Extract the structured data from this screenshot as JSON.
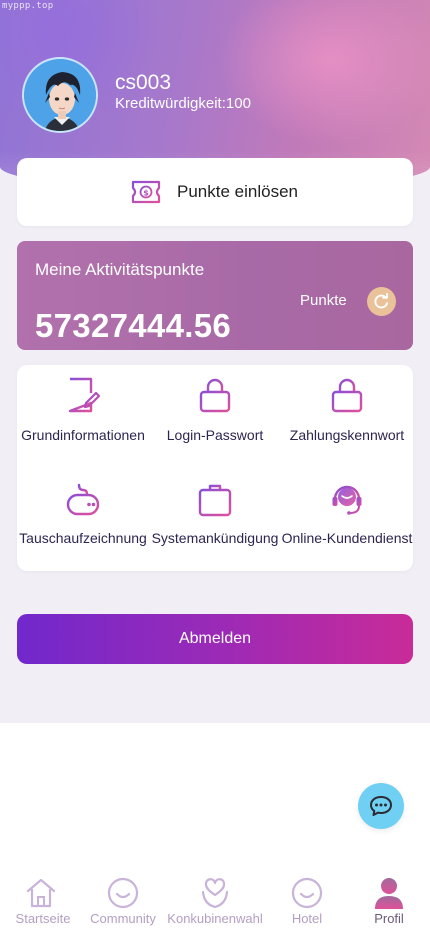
{
  "watermark": "myppp.top",
  "profile": {
    "username": "cs003",
    "credit_text": "Kreditwürdigkeit:100"
  },
  "redeem": {
    "label": "Punkte einlösen",
    "icon": "coupon-icon"
  },
  "points": {
    "title": "Meine Aktivitätspunkte",
    "value": "57327444.56",
    "unit": "Punkte",
    "refresh_icon": "refresh-icon"
  },
  "menu": {
    "items": [
      {
        "label": "Grundinformationen",
        "icon": "document-edit-icon"
      },
      {
        "label": "Login-Passwort",
        "icon": "lock-icon"
      },
      {
        "label": "Zahlungskennwort",
        "icon": "lock-icon"
      },
      {
        "label": "Tauschaufzeichnung",
        "icon": "gamepad-icon"
      },
      {
        "label": "Systemankündigung",
        "icon": "briefcase-icon"
      },
      {
        "label": "Online-Kundendienst",
        "icon": "headset-icon"
      }
    ]
  },
  "logout": {
    "label": "Abmelden"
  },
  "chat_fab": {
    "icon": "chat-icon"
  },
  "tabbar": {
    "items": [
      {
        "label": "Startseite",
        "icon": "home-icon",
        "active": false
      },
      {
        "label": "Community",
        "icon": "smile-icon",
        "active": false
      },
      {
        "label": "Konkubinenwahl",
        "icon": "heart-person-icon",
        "active": false
      },
      {
        "label": "Hotel",
        "icon": "smile-icon",
        "active": false
      },
      {
        "label": "Profil",
        "icon": "user-icon",
        "active": true
      }
    ]
  },
  "colors": {
    "accent_purple": "#7128cc",
    "accent_pink": "#c92b98",
    "points_card": "#a86aa6",
    "icon_gradient_start": "#8a4fd8",
    "icon_gradient_end": "#e0509a",
    "fab": "#6fd0f3",
    "tab_inactive": "#b49ec4"
  }
}
